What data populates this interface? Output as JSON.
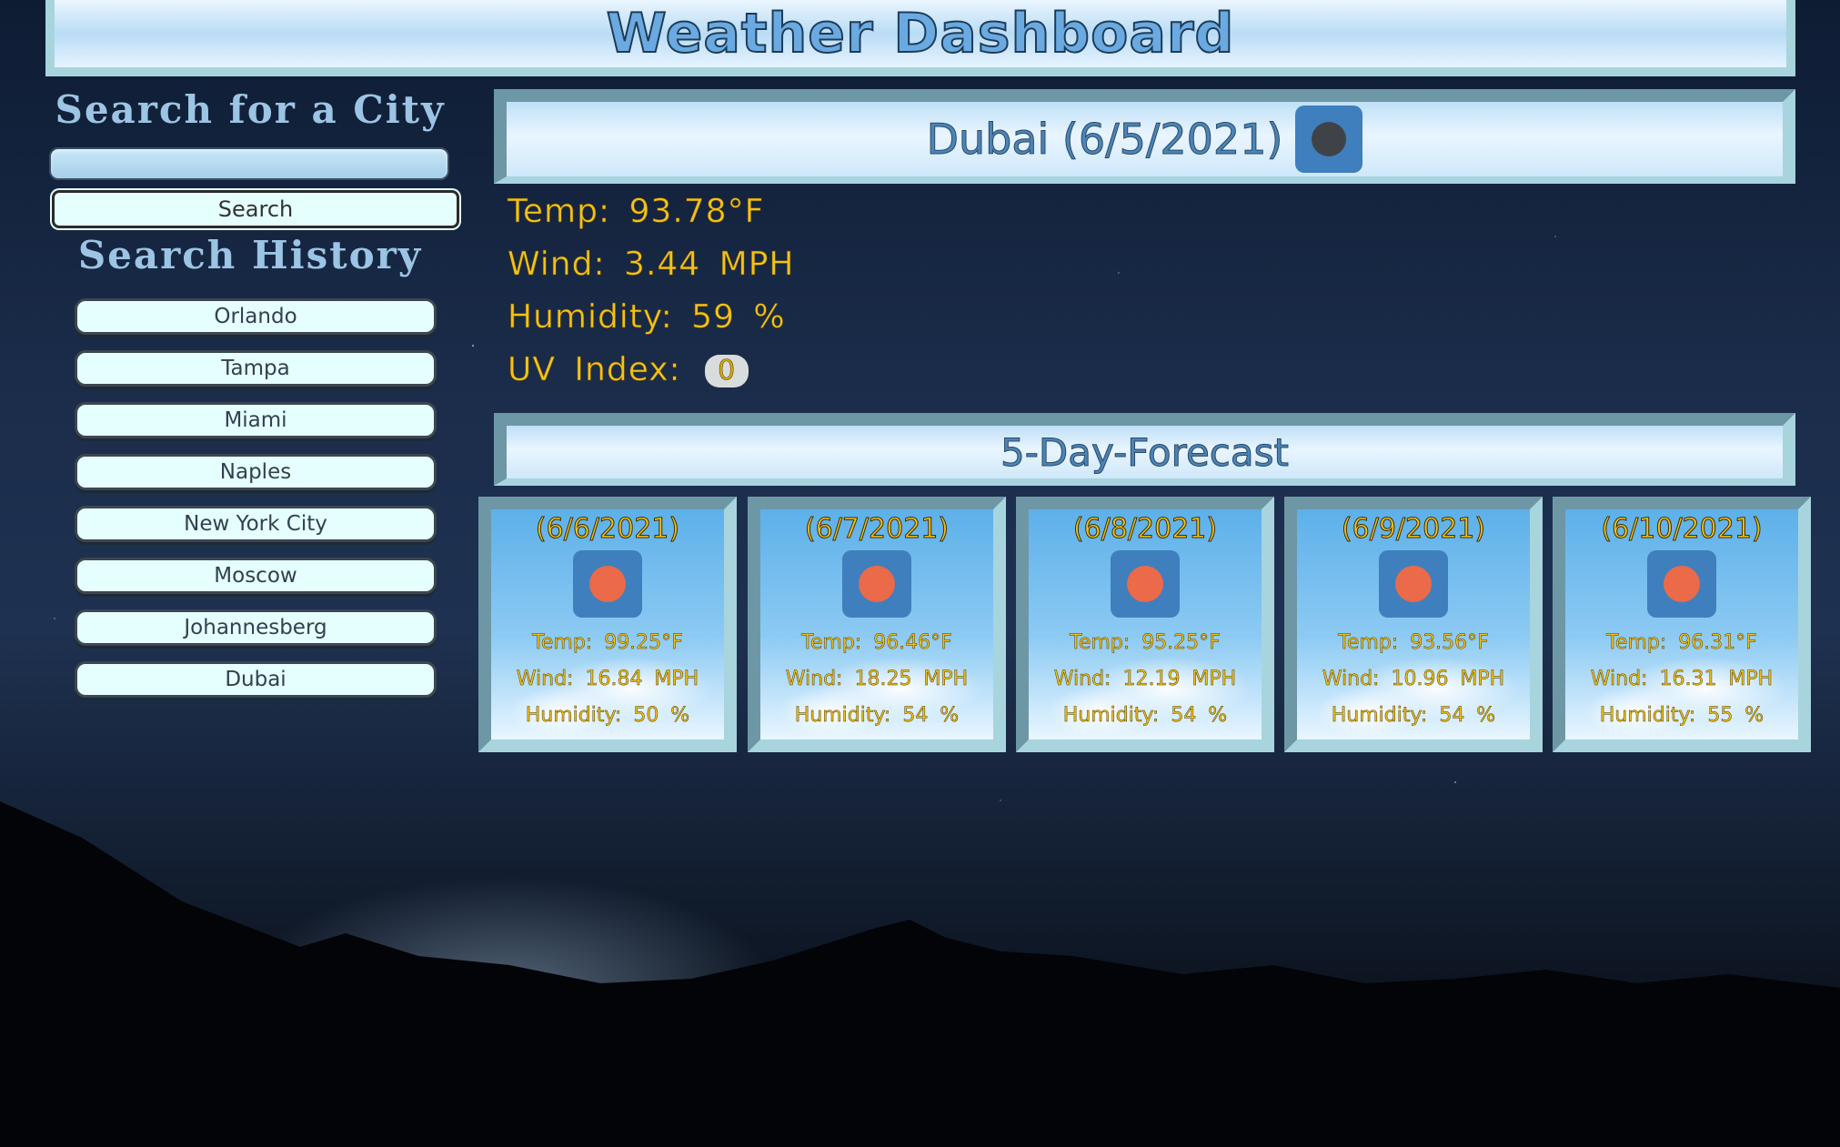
{
  "app": {
    "title": "Weather Dashboard"
  },
  "sidebar": {
    "search_heading": "Search for a City",
    "search_input": {
      "value": "",
      "placeholder": ""
    },
    "search_button": "Search",
    "history_heading": "Search History",
    "history": [
      "Orlando",
      "Tampa",
      "Miami",
      "Naples",
      "New York City",
      "Moscow",
      "Johannesberg",
      "Dubai"
    ]
  },
  "current": {
    "title": "Dubai (6/5/2021)",
    "icon": "moon-icon",
    "temp": "Temp: 93.78°F",
    "wind": "Wind: 3.44 MPH",
    "humidity": "Humidity: 59 %",
    "uv_label": "UV Index:",
    "uv_value": "0"
  },
  "forecast": {
    "title": "5-Day-Forecast",
    "days": [
      {
        "date": "(6/6/2021)",
        "icon": "sun-icon",
        "temp": "Temp: 99.25°F",
        "wind": "Wind: 16.84 MPH",
        "humidity": "Humidity: 50 %"
      },
      {
        "date": "(6/7/2021)",
        "icon": "sun-icon",
        "temp": "Temp: 96.46°F",
        "wind": "Wind: 18.25 MPH",
        "humidity": "Humidity: 54 %"
      },
      {
        "date": "(6/8/2021)",
        "icon": "sun-icon",
        "temp": "Temp: 95.25°F",
        "wind": "Wind: 12.19 MPH",
        "humidity": "Humidity: 54 %"
      },
      {
        "date": "(6/9/2021)",
        "icon": "sun-icon",
        "temp": "Temp: 93.56°F",
        "wind": "Wind: 10.96 MPH",
        "humidity": "Humidity: 54 %"
      },
      {
        "date": "(6/10/2021)",
        "icon": "sun-icon",
        "temp": "Temp: 96.31°F",
        "wind": "Wind: 16.31 MPH",
        "humidity": "Humidity: 55 %"
      }
    ]
  },
  "colors": {
    "accent_yellow": "#f2c21c",
    "icon_bg": "#3f7fbd",
    "sun": "#ea6a49",
    "button_bg": "#e5fffe"
  }
}
